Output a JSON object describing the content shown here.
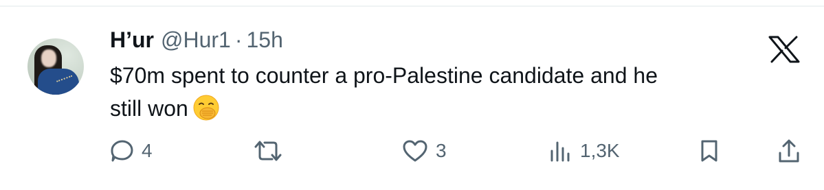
{
  "tweet": {
    "author": {
      "display_name": "H’ur",
      "handle": "@Hur1",
      "separator": "·",
      "time": "15h",
      "avatar": "avatar-woman-blue-dress"
    },
    "text_line1": "$70m spent to counter a pro-Palestine candidate and he",
    "text_line2": "still won",
    "emoji": "face-with-hand-over-mouth-emoji",
    "platform_icon": "x-logo-icon",
    "actions": {
      "reply": {
        "icon": "reply-icon",
        "count": "4"
      },
      "retweet": {
        "icon": "retweet-icon",
        "count": ""
      },
      "like": {
        "icon": "like-icon",
        "count": "3"
      },
      "views": {
        "icon": "views-icon",
        "count": "1,3K"
      },
      "bookmark": {
        "icon": "bookmark-icon"
      },
      "share": {
        "icon": "share-icon"
      }
    }
  },
  "colors": {
    "text": "#0f1419",
    "secondary": "#536471",
    "divider": "#eff3f4",
    "background": "#ffffff"
  }
}
